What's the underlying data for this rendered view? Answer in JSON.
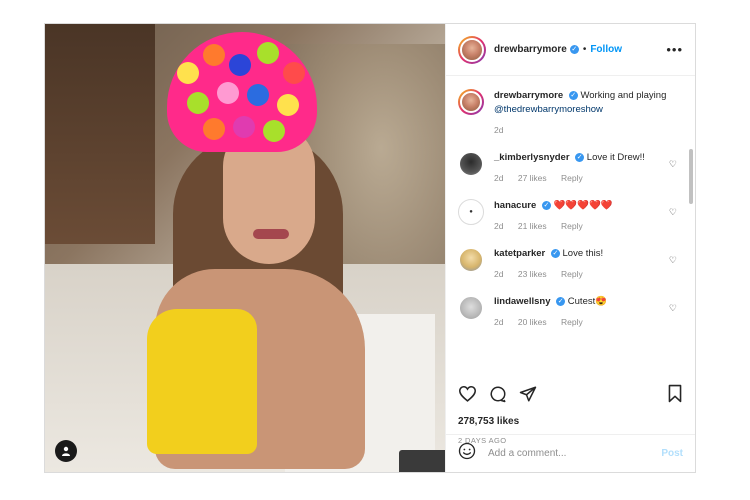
{
  "post": {
    "author": "drewbarrymore",
    "follow_label": "Follow",
    "caption_text": "Working and playing",
    "caption_mention": "@thedrewbarrymoreshow",
    "caption_time": "2d",
    "likes": "278,753 likes",
    "date": "2 DAYS AGO",
    "comment_placeholder": "Add a comment...",
    "post_label": "Post"
  },
  "comments": [
    {
      "user": "_kimberlysnyder",
      "text": "Love it Drew!!",
      "time": "2d",
      "likes": "27 likes",
      "reply": "Reply"
    },
    {
      "user": "hanacure",
      "text": "❤️❤️❤️❤️❤️",
      "time": "2d",
      "likes": "21 likes",
      "reply": "Reply"
    },
    {
      "user": "katetparker",
      "text": "Love this!",
      "time": "2d",
      "likes": "23 likes",
      "reply": "Reply"
    },
    {
      "user": "lindawellsny",
      "text": "Cutest😍",
      "time": "2d",
      "likes": "20 likes",
      "reply": "Reply"
    }
  ],
  "icons": {
    "verified": "verified-badge-icon",
    "more": "more-options-icon",
    "like": "heart-icon",
    "comment": "comment-bubble-icon",
    "share": "paper-plane-icon",
    "save": "bookmark-icon",
    "emoji": "emoji-icon",
    "profile_tag": "user-tag-icon"
  },
  "colors": {
    "follow": "#0095f6",
    "verified": "#3897f0",
    "muted": "#8e8e8e",
    "post_disabled": "#b2dffc"
  }
}
